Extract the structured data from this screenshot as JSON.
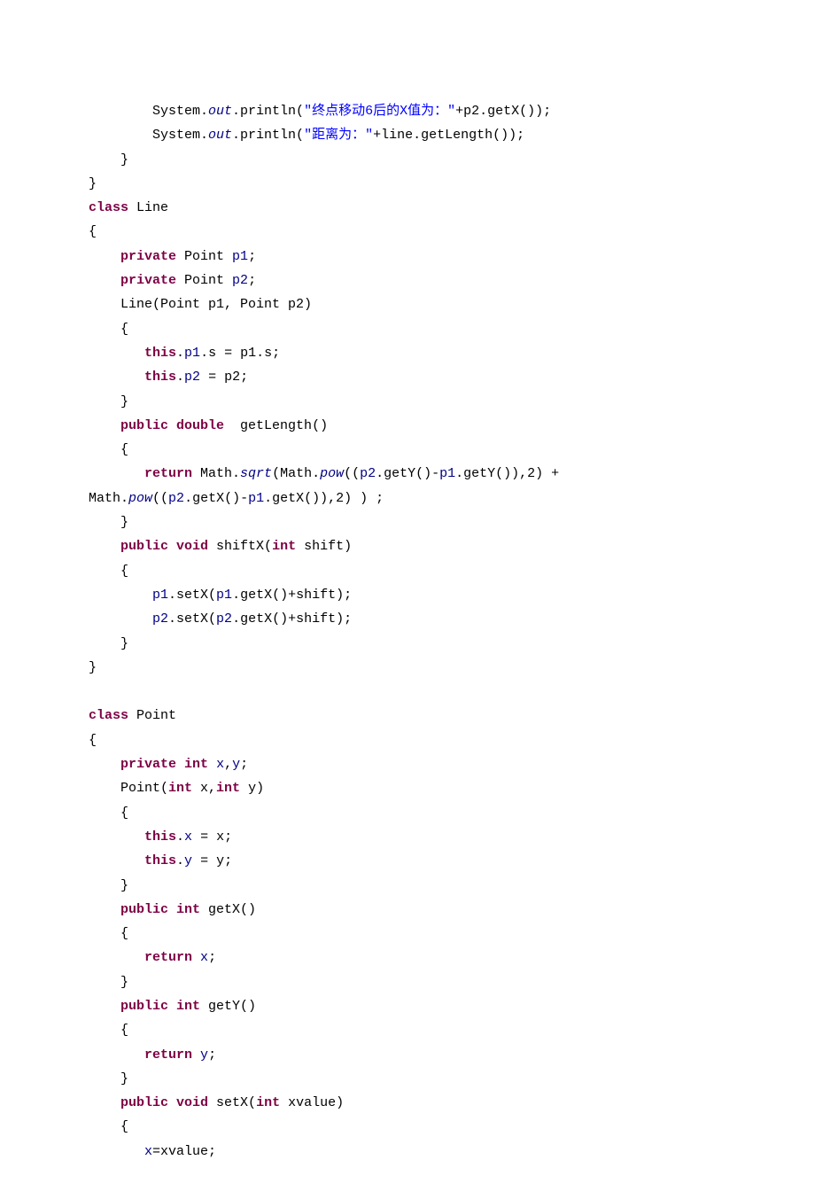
{
  "c": {
    "l1a": "        System.",
    "l1b": "out",
    "l1c": ".println(",
    "l1d": "\"终点移动6后的X值为：\"",
    "l1e": "+p2.getX());",
    "l2a": "        System.",
    "l2b": "out",
    "l2c": ".println(",
    "l2d": "\"距离为：\"",
    "l2e": "+line.getLength());",
    "l3": "    }",
    "l4": "}",
    "l5a": "class",
    "l5b": " Line",
    "l6": "{",
    "l7a": "    ",
    "l7b": "private",
    "l7c": " Point ",
    "l7d": "p1",
    "l7e": ";",
    "l8a": "    ",
    "l8b": "private",
    "l8c": " Point ",
    "l8d": "p2",
    "l8e": ";",
    "l9": "    Line(Point p1, Point p2)",
    "l10": "    {",
    "l11a": "       ",
    "l11b": "this",
    "l11c": ".",
    "l11d": "p1",
    "l11e": ".s = p1.s;",
    "l12a": "       ",
    "l12b": "this",
    "l12c": ".",
    "l12d": "p2",
    "l12e": " = p2;",
    "l13": "    }",
    "l14a": "    ",
    "l14b": "public double",
    "l14c": "  getLength()",
    "l15": "    {",
    "l16a": "       ",
    "l16b": "return",
    "l16c": " Math.",
    "l16d": "sqrt",
    "l16e": "(Math.",
    "l16f": "pow",
    "l16g": "((",
    "l16h": "p2",
    "l16i": ".getY()-",
    "l16j": "p1",
    "l16k": ".getY()),2) +",
    "l17a": "Math.",
    "l17b": "pow",
    "l17c": "((",
    "l17d": "p2",
    "l17e": ".getX()-",
    "l17f": "p1",
    "l17g": ".getX()),2) ) ;",
    "l18": "    }",
    "l19a": "    ",
    "l19b": "public void",
    "l19c": " shiftX(",
    "l19d": "int",
    "l19e": " shift)",
    "l20": "    {",
    "l21a": "        ",
    "l21b": "p1",
    "l21c": ".setX(",
    "l21d": "p1",
    "l21e": ".getX()+shift);",
    "l22a": "        ",
    "l22b": "p2",
    "l22c": ".setX(",
    "l22d": "p2",
    "l22e": ".getX()+shift);",
    "l23": "    }",
    "l24": "}",
    "blank1": " ",
    "l25a": "class",
    "l25b": " Point",
    "l26": "{",
    "l27a": "    ",
    "l27b": "private int",
    "l27c": " ",
    "l27d": "x",
    "l27e": ",",
    "l27f": "y",
    "l27g": ";",
    "l28a": "    Point(",
    "l28b": "int",
    "l28c": " x,",
    "l28d": "int",
    "l28e": " y)",
    "l29": "    {",
    "l30a": "       ",
    "l30b": "this",
    "l30c": ".",
    "l30d": "x",
    "l30e": " = x;",
    "l31a": "       ",
    "l31b": "this",
    "l31c": ".",
    "l31d": "y",
    "l31e": " = y;",
    "l32": "    }",
    "l33a": "    ",
    "l33b": "public int",
    "l33c": " getX()",
    "l34": "    {",
    "l35a": "       ",
    "l35b": "return",
    "l35c": " ",
    "l35d": "x",
    "l35e": ";",
    "l36": "    }",
    "l37a": "    ",
    "l37b": "public int",
    "l37c": " getY()",
    "l38": "    {",
    "l39a": "       ",
    "l39b": "return",
    "l39c": " ",
    "l39d": "y",
    "l39e": ";",
    "l40": "    }",
    "l41a": "    ",
    "l41b": "public void",
    "l41c": " setX(",
    "l41d": "int",
    "l41e": " xvalue)",
    "l42": "    {",
    "l43a": "       ",
    "l43b": "x",
    "l43c": "=xvalue;"
  }
}
